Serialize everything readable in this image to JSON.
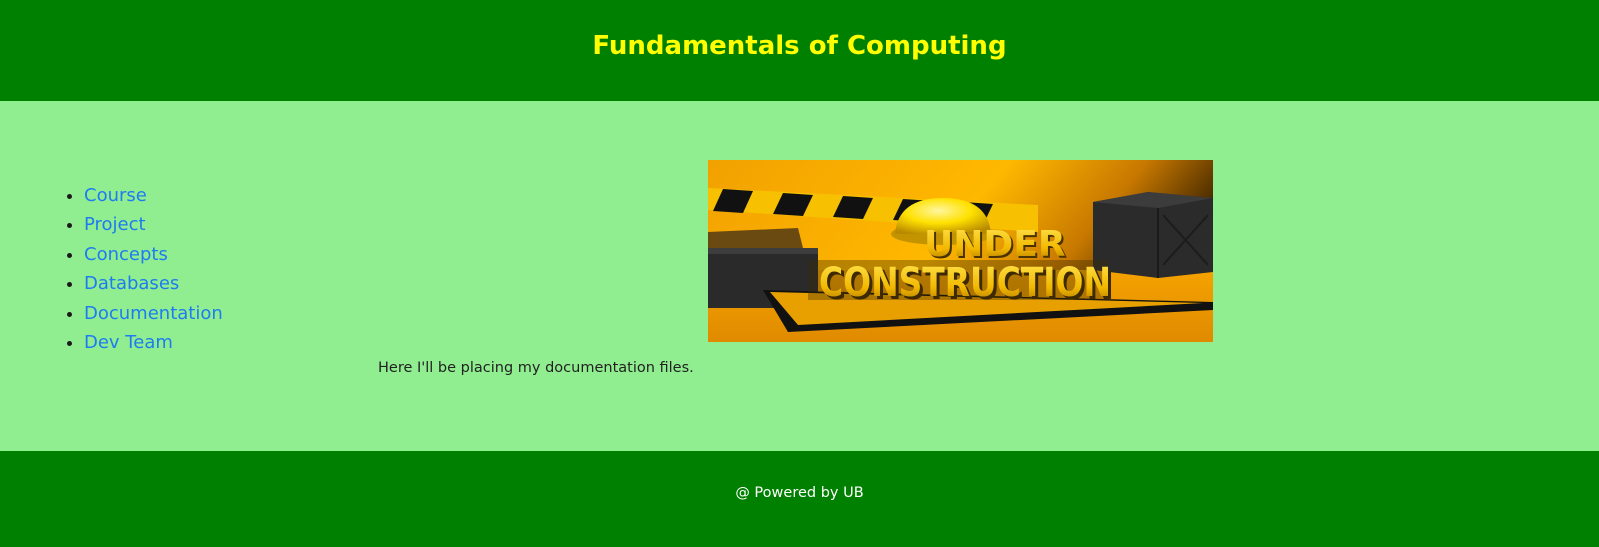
{
  "colors": {
    "header_bg": "#008000",
    "title": "#ffff00",
    "main_bg": "#90ee90",
    "link": "#1e7bf2",
    "footer_bg": "#008000",
    "footer_text": "#ffffff"
  },
  "header": {
    "title": "Fundamentals of Computing"
  },
  "nav": {
    "items": [
      {
        "label": "Course"
      },
      {
        "label": "Project"
      },
      {
        "label": "Concepts"
      },
      {
        "label": "Databases"
      },
      {
        "label": "Documentation"
      },
      {
        "label": "Dev Team"
      }
    ]
  },
  "banner": {
    "word1": "UNDER",
    "word2": "CONSTRUCTION"
  },
  "content": {
    "text": "Here I'll be placing my documentation files."
  },
  "footer": {
    "text": "@ Powered by UB"
  }
}
